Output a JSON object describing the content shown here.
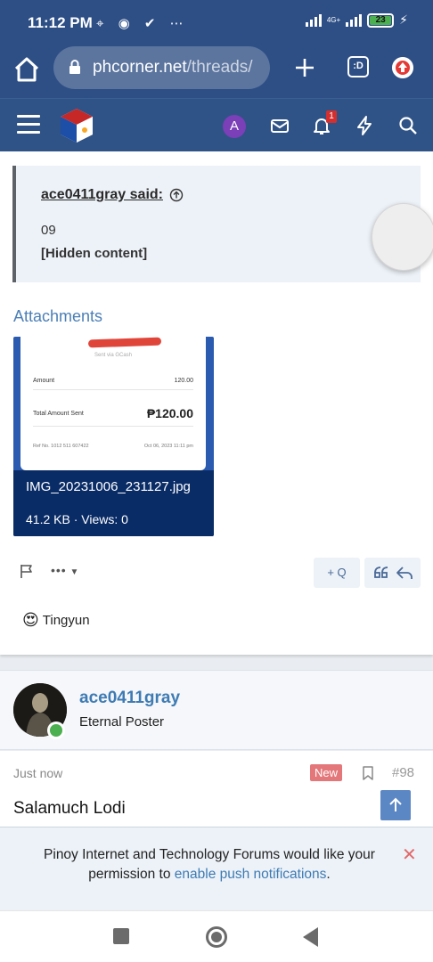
{
  "status_bar": {
    "time": "11:12 PM",
    "icons": "⌖ ◉ ✔ ⋯",
    "network": "4G+",
    "battery": "23"
  },
  "browser": {
    "url_host": "phcorner.net",
    "url_path": "/threads/",
    "tabs_label": ":D"
  },
  "forum_header": {
    "avatar_letter": "A",
    "alerts_count": "1"
  },
  "post": {
    "quote_author": "ace0411gray said:",
    "quote_line1": "09",
    "quote_line2": "[Hidden content]",
    "attachments_title": "Attachments",
    "attachment": {
      "filename": "IMG_20231006_231127.jpg",
      "meta": "41.2 KB · Views: 0",
      "receipt_sub": "Sent via GCash",
      "receipt_amount_label": "Amount",
      "receipt_amount_value": "120.00",
      "receipt_total_label": "Total Amount Sent",
      "receipt_total_value": "₱120.00",
      "receipt_ref": "Ref No. 1012 511 607422",
      "receipt_date": "Oct 06, 2023 11:11 pm"
    },
    "more_label": "•••",
    "quote_button_label": "+ Q",
    "reaction_emoji": "😍",
    "reaction_user": "Tingyun"
  },
  "post2": {
    "username": "ace0411gray",
    "user_title": "Eternal Poster",
    "time": "Just now",
    "new_badge": "New",
    "post_number": "#98",
    "body": "Salamuch Lodi"
  },
  "notice": {
    "text_before": "Pinoy Internet and Technology Forums would like your permission to ",
    "link": "enable push notifications",
    "text_after": ".",
    "close": "✕"
  },
  "colors": {
    "brand": "#2e4f85",
    "link": "#3e7bb3",
    "new_badge": "#e3777a"
  }
}
